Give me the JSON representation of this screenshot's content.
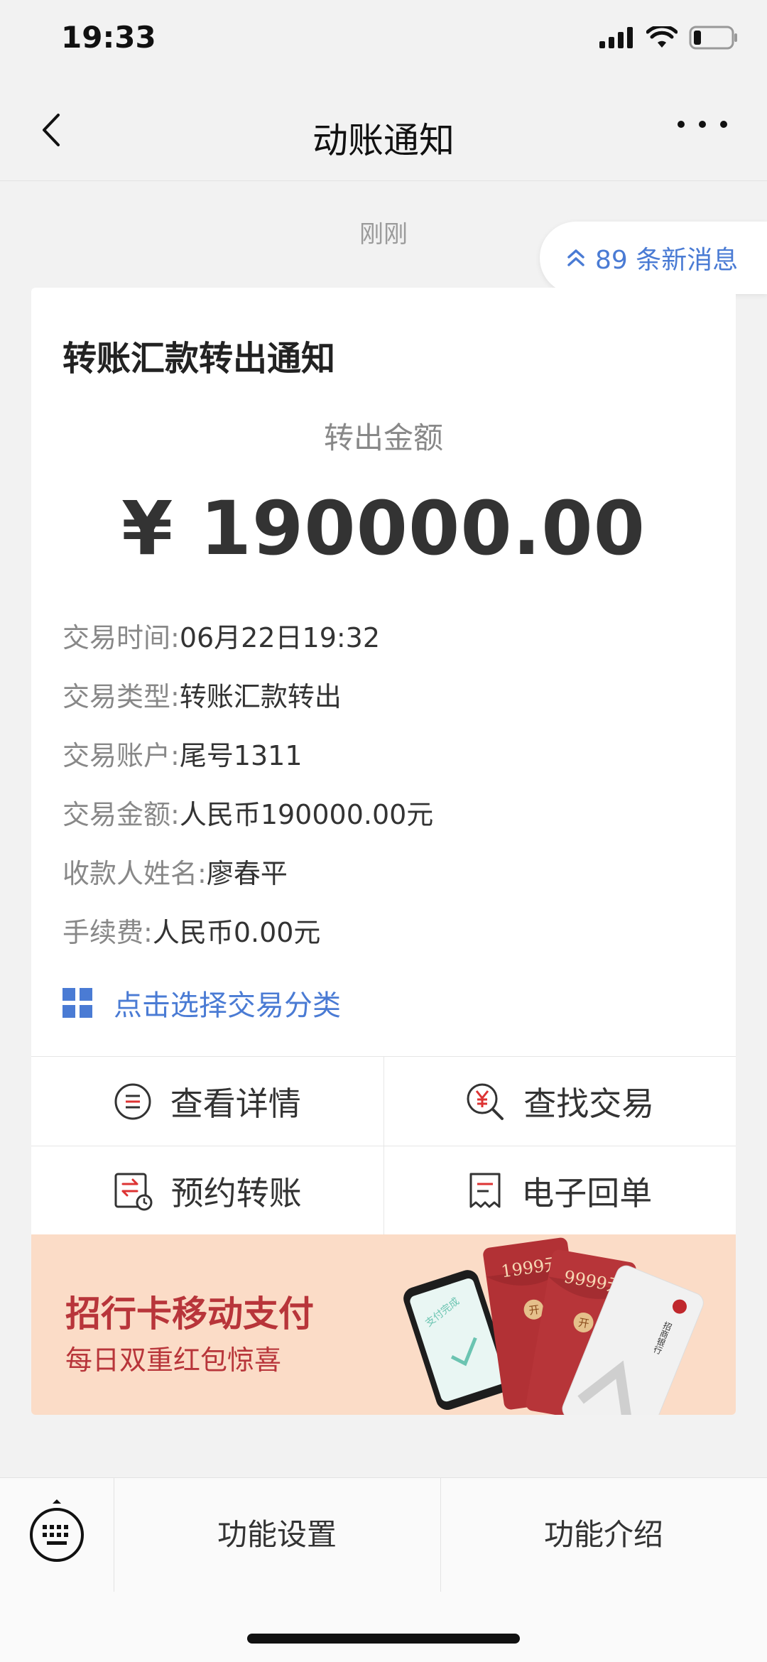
{
  "status_bar": {
    "time": "19:33"
  },
  "nav": {
    "title": "动账通知"
  },
  "timestamp": "刚刚",
  "new_messages": "89 条新消息",
  "card": {
    "title": "转账汇款转出通知",
    "amount_label": "转出金额",
    "amount": "¥ 190000.00",
    "details": [
      {
        "key": "交易时间:",
        "value": "06月22日19:32"
      },
      {
        "key": "交易类型:",
        "value": "转账汇款转出"
      },
      {
        "key": "交易账户:",
        "value": "尾号1311"
      },
      {
        "key": "交易金额:",
        "value": "人民币190000.00元"
      },
      {
        "key": "收款人姓名:",
        "value": "廖春平"
      },
      {
        "key": "手续费:",
        "value": "人民币0.00元"
      }
    ],
    "classify_link": "点击选择交易分类"
  },
  "actions": {
    "view_details": "查看详情",
    "find_transaction": "查找交易",
    "scheduled_transfer": "预约转账",
    "e_receipt": "电子回单"
  },
  "banner": {
    "title": "招行卡移动支付",
    "subtitle": "每日双重红包惊喜",
    "phone_text": "支付完成",
    "envelope1": "1999元",
    "envelope2": "9999元",
    "open_label": "开",
    "card_brand": "招商银行"
  },
  "bottom_bar": {
    "settings": "功能设置",
    "intro": "功能介绍"
  },
  "colors": {
    "accent_blue": "#4a7bd4",
    "banner_bg": "#fbdcc7",
    "banner_red": "#b8353a"
  }
}
